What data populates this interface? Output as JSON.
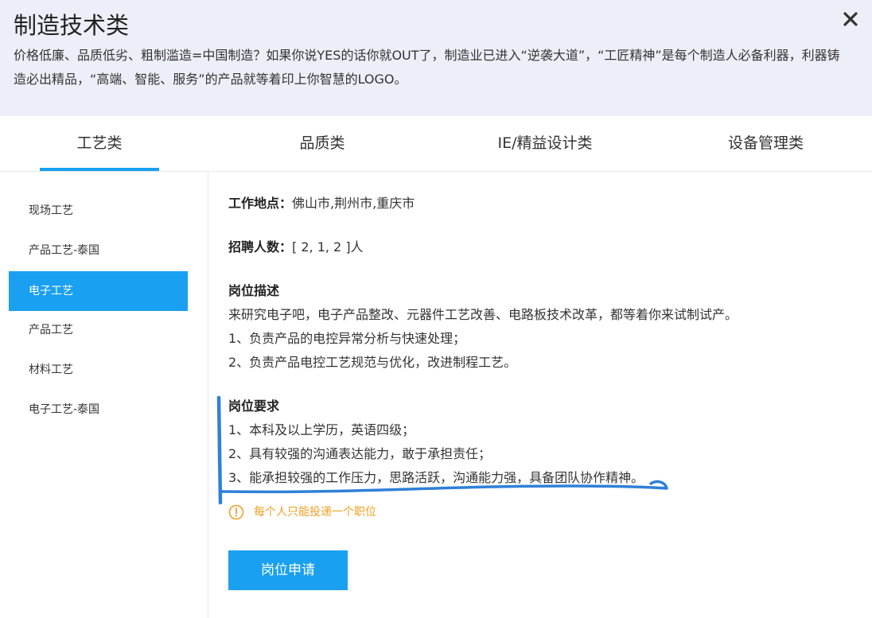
{
  "header": {
    "title": "制造技术类",
    "description": "价格低廉、品质低劣、粗制滥造=中国制造？如果你说YES的话你就OUT了，制造业已进入“逆袭大道”，“工匠精神”是每个制造人必备利器，利器铸造必出精品，“高端、智能、服务”的产品就等着印上你智慧的LOGO。",
    "close_icon": "close-icon"
  },
  "tabs": [
    {
      "label": "工艺类",
      "active": true
    },
    {
      "label": "品质类",
      "active": false
    },
    {
      "label": "IE/精益设计类",
      "active": false
    },
    {
      "label": "设备管理类",
      "active": false
    }
  ],
  "sidebar": {
    "items": [
      {
        "label": "现场工艺",
        "active": false
      },
      {
        "label": "产品工艺-泰国",
        "active": false
      },
      {
        "label": "电子工艺",
        "active": true
      },
      {
        "label": "产品工艺",
        "active": false
      },
      {
        "label": "材料工艺",
        "active": false
      },
      {
        "label": "电子工艺-泰国",
        "active": false
      }
    ]
  },
  "job": {
    "location_label": "工作地点：",
    "location_value": "佛山市,荆州市,重庆市",
    "headcount_label": "招聘人数：",
    "headcount_value": "[ 2, 1, 2 ]人",
    "desc_title": "岗位描述",
    "desc_lines": [
      "来研究电子吧，电子产品整改、元器件工艺改善、电路板技术改革，都等着你来试制试产。",
      "1、负责产品的电控异常分析与快速处理；",
      "2、负责产品电控工艺规范与优化，改进制程工艺。"
    ],
    "req_title": "岗位要求",
    "req_lines": [
      "1、本科及以上学历，英语四级；",
      "2、具有较强的沟通表达能力，敢于承担责任；",
      "3、能承担较强的工作压力，思路活跃，沟通能力强，具备团队协作精神。"
    ]
  },
  "notice": {
    "icon": "warning-circle-icon",
    "text": "每个人只能投递一个职位"
  },
  "apply_button": {
    "label": "岗位申请"
  },
  "colors": {
    "accent": "#1aa0f0",
    "header_bg": "#eceff7",
    "notice": "#f0a020",
    "annotation": "#2f80d8"
  }
}
